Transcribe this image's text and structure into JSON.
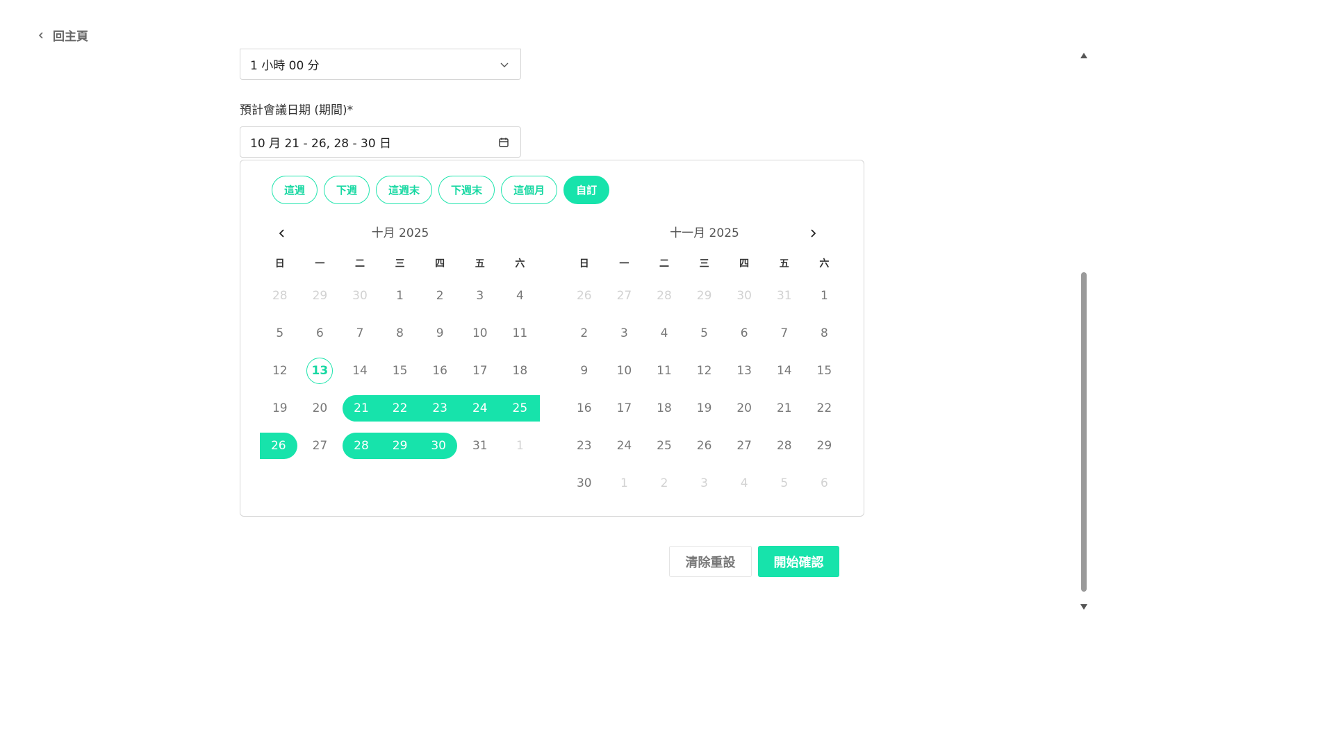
{
  "back": {
    "label": "回主頁"
  },
  "duration": {
    "value": "1 小時 00 分"
  },
  "date_field": {
    "label": "預計會議日期 (期間)*",
    "value": "10 月 21 - 26, 28 - 30 日"
  },
  "presets": [
    "這週",
    "下週",
    "這週末",
    "下週末",
    "這個月",
    "自訂"
  ],
  "active_preset": "自訂",
  "weekdays": [
    "日",
    "一",
    "二",
    "三",
    "四",
    "五",
    "六"
  ],
  "months": [
    {
      "title": "十月 2025",
      "days": [
        {
          "d": "28",
          "out": true
        },
        {
          "d": "29",
          "out": true
        },
        {
          "d": "30",
          "out": true
        },
        {
          "d": "1"
        },
        {
          "d": "2"
        },
        {
          "d": "3"
        },
        {
          "d": "4"
        },
        {
          "d": "5"
        },
        {
          "d": "6"
        },
        {
          "d": "7"
        },
        {
          "d": "8"
        },
        {
          "d": "9"
        },
        {
          "d": "10"
        },
        {
          "d": "11"
        },
        {
          "d": "12"
        },
        {
          "d": "13",
          "today": true
        },
        {
          "d": "14"
        },
        {
          "d": "15"
        },
        {
          "d": "16"
        },
        {
          "d": "17"
        },
        {
          "d": "18"
        },
        {
          "d": "19"
        },
        {
          "d": "20"
        },
        {
          "d": "21",
          "sel": "start"
        },
        {
          "d": "22",
          "sel": "mid"
        },
        {
          "d": "23",
          "sel": "mid"
        },
        {
          "d": "24",
          "sel": "mid"
        },
        {
          "d": "25",
          "sel": "mid"
        },
        {
          "d": "26",
          "sel": "single-end"
        },
        {
          "d": "27"
        },
        {
          "d": "28",
          "sel": "start"
        },
        {
          "d": "29",
          "sel": "mid"
        },
        {
          "d": "30",
          "sel": "end"
        },
        {
          "d": "31"
        },
        {
          "d": "1",
          "out": true
        }
      ]
    },
    {
      "title": "十一月 2025",
      "days": [
        {
          "d": "26",
          "out": true
        },
        {
          "d": "27",
          "out": true
        },
        {
          "d": "28",
          "out": true
        },
        {
          "d": "29",
          "out": true
        },
        {
          "d": "30",
          "out": true
        },
        {
          "d": "31",
          "out": true
        },
        {
          "d": "1"
        },
        {
          "d": "2"
        },
        {
          "d": "3"
        },
        {
          "d": "4"
        },
        {
          "d": "5"
        },
        {
          "d": "6"
        },
        {
          "d": "7"
        },
        {
          "d": "8"
        },
        {
          "d": "9"
        },
        {
          "d": "10"
        },
        {
          "d": "11"
        },
        {
          "d": "12"
        },
        {
          "d": "13"
        },
        {
          "d": "14"
        },
        {
          "d": "15"
        },
        {
          "d": "16"
        },
        {
          "d": "17"
        },
        {
          "d": "18"
        },
        {
          "d": "19"
        },
        {
          "d": "20"
        },
        {
          "d": "21"
        },
        {
          "d": "22"
        },
        {
          "d": "23"
        },
        {
          "d": "24"
        },
        {
          "d": "25"
        },
        {
          "d": "26"
        },
        {
          "d": "27"
        },
        {
          "d": "28"
        },
        {
          "d": "29"
        },
        {
          "d": "30"
        },
        {
          "d": "1",
          "out": true
        },
        {
          "d": "2",
          "out": true
        },
        {
          "d": "3",
          "out": true
        },
        {
          "d": "4",
          "out": true
        },
        {
          "d": "5",
          "out": true
        },
        {
          "d": "6",
          "out": true
        }
      ]
    }
  ],
  "actions": {
    "reset": "清除重設",
    "confirm": "開始確認"
  },
  "colors": {
    "accent": "#17e3ab",
    "accent_text": "#17d8a2",
    "muted": "#777777",
    "out": "#d2d2d2"
  },
  "icons": {
    "back": "chevron-left-icon",
    "dropdown": "chevron-down-icon",
    "calendar": "calendar-icon",
    "prev": "chevron-left-icon",
    "next": "chevron-right-icon"
  }
}
